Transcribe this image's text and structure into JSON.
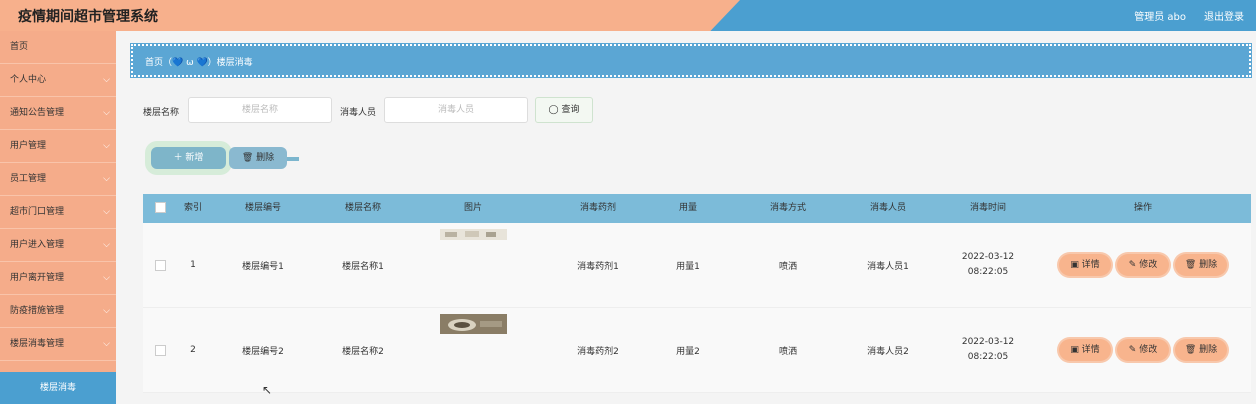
{
  "app": {
    "title": "疫情期间超市管理系统",
    "admin": "管理员 abo",
    "logout": "退出登录"
  },
  "sidebar": {
    "items": [
      {
        "label": "首页",
        "chevron": ""
      },
      {
        "label": "个人中心",
        "chevron": "⌵"
      },
      {
        "label": "通知公告管理",
        "chevron": "⌵"
      },
      {
        "label": "用户管理",
        "chevron": "⌵"
      },
      {
        "label": "员工管理",
        "chevron": "⌵"
      },
      {
        "label": "超市门口管理",
        "chevron": "⌵"
      },
      {
        "label": "用户进入管理",
        "chevron": "⌵"
      },
      {
        "label": "用户离开管理",
        "chevron": "⌵"
      },
      {
        "label": "防疫措施管理",
        "chevron": "⌵"
      },
      {
        "label": "楼层消毒管理",
        "chevron": "⌵"
      }
    ],
    "active_sub": "楼层消毒"
  },
  "breadcrumb": "首页（💙 ω 💙）楼层消毒",
  "search": {
    "floor_label": "楼层名称",
    "floor_placeholder": "楼层名称",
    "person_label": "消毒人员",
    "person_placeholder": "消毒人员",
    "query_label": "◯ 查询"
  },
  "actions": {
    "add_label": "＋ 新增",
    "delete_label": "🗑 删除"
  },
  "table": {
    "headers": [
      "索引",
      "楼层编号",
      "楼层名称",
      "图片",
      "消毒药剂",
      "用量",
      "消毒方式",
      "消毒人员",
      "消毒时间",
      "操作"
    ],
    "rows": [
      {
        "index": "1",
        "floor_no": "楼层编号1",
        "floor_name": "楼层名称1",
        "agent": "消毒药剂1",
        "amount": "用量1",
        "method": "喷洒",
        "person": "消毒人员1",
        "time": "2022-03-12 08:22:05"
      },
      {
        "index": "2",
        "floor_no": "楼层编号2",
        "floor_name": "楼层名称2",
        "agent": "消毒药剂2",
        "amount": "用量2",
        "method": "喷洒",
        "person": "消毒人员2",
        "time": "2022-03-12 08:22:05"
      }
    ],
    "op_labels": {
      "detail": "▣ 详情",
      "edit": "✎ 修改",
      "delete": "🗑 删除"
    }
  },
  "colors": {
    "orange": "#f5ac8a",
    "blue": "#4b9fd0",
    "table_header": "#7cbbd9"
  }
}
